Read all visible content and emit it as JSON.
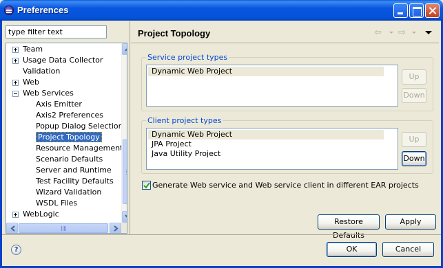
{
  "window": {
    "title": "Preferences"
  },
  "filter": {
    "value": "type filter text"
  },
  "tree": {
    "items": [
      {
        "label": "Team",
        "expander": "plus"
      },
      {
        "label": "Usage Data Collector",
        "expander": "plus"
      },
      {
        "label": "Validation",
        "expander": "none"
      },
      {
        "label": "Web",
        "expander": "plus"
      },
      {
        "label": "Web Services",
        "expander": "minus"
      },
      {
        "label": "Axis Emitter",
        "expander": "none"
      },
      {
        "label": "Axis2 Preferences",
        "expander": "none"
      },
      {
        "label": "Popup Dialog Selection",
        "expander": "none"
      },
      {
        "label": "Project Topology",
        "expander": "none",
        "selected": true
      },
      {
        "label": "Resource Management",
        "expander": "none"
      },
      {
        "label": "Scenario Defaults",
        "expander": "none"
      },
      {
        "label": "Server and Runtime",
        "expander": "none"
      },
      {
        "label": "Test Facility Defaults",
        "expander": "none"
      },
      {
        "label": "Wizard Validation",
        "expander": "none"
      },
      {
        "label": "WSDL Files",
        "expander": "none"
      },
      {
        "label": "WebLogic",
        "expander": "plus"
      }
    ]
  },
  "page": {
    "title": "Project Topology",
    "service_group": {
      "label": "Service project types",
      "items": [
        "Dynamic Web Project"
      ],
      "up_label": "Up",
      "down_label": "Down"
    },
    "client_group": {
      "label": "Client project types",
      "items": [
        "Dynamic Web Project",
        "JPA Project",
        "Java Utility Project"
      ],
      "up_label": "Up",
      "down_label": "Down"
    },
    "checkbox": {
      "label": "Generate Web service and Web service client in different EAR projects",
      "checked": true
    },
    "restore_label": "Restore Defaults",
    "apply_label": "Apply"
  },
  "footer": {
    "help_icon": "?",
    "ok_label": "OK",
    "cancel_label": "Cancel"
  },
  "colors": {
    "selection": "#316ac5",
    "group_label": "#0046d5",
    "titlebar": "#0856e0"
  }
}
